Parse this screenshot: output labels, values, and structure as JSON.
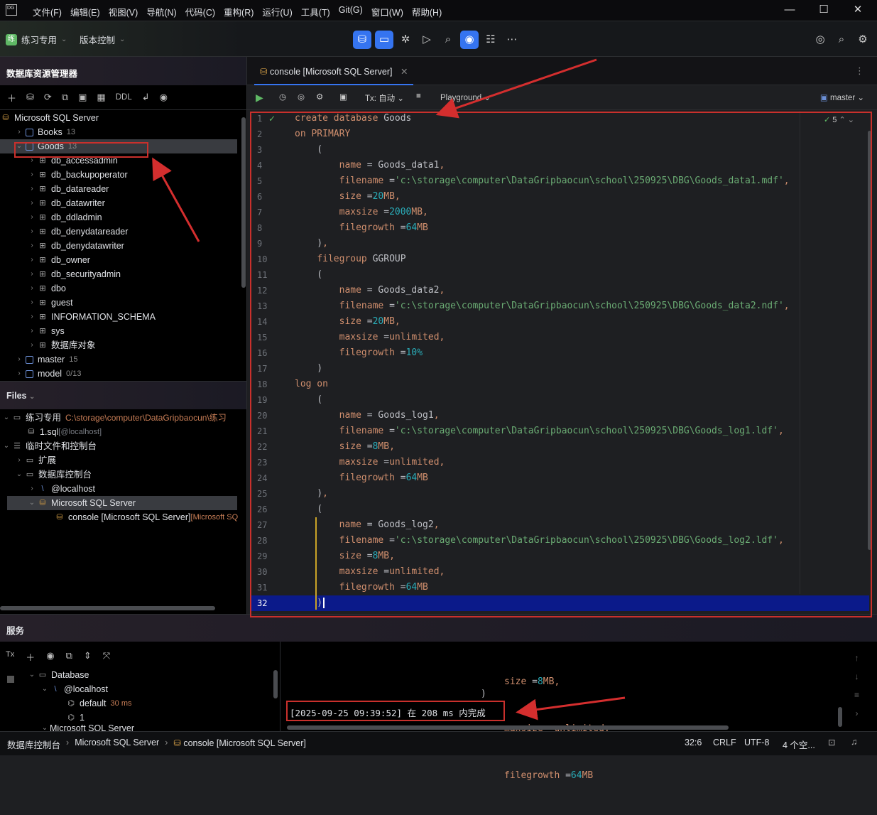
{
  "menu": [
    "文件(F)",
    "编辑(E)",
    "视图(V)",
    "导航(N)",
    "代码(C)",
    "重构(R)",
    "运行(U)",
    "工具(T)",
    "Git(G)",
    "窗口(W)",
    "帮助(H)"
  ],
  "app_logo": "DG",
  "toolbar": {
    "project": "练习专用",
    "vcs": "版本控制",
    "project_badge": "练"
  },
  "db_explorer": {
    "title": "数据库资源管理器",
    "ddl": "DDL",
    "root": "Microsoft SQL Server",
    "books": {
      "name": "Books",
      "count": "13"
    },
    "goods": {
      "name": "Goods",
      "count": "13"
    },
    "schemas": [
      "db_accessadmin",
      "db_backupoperator",
      "db_datareader",
      "db_datawriter",
      "db_ddladmin",
      "db_denydatareader",
      "db_denydatawriter",
      "db_owner",
      "db_securityadmin",
      "dbo",
      "guest",
      "INFORMATION_SCHEMA",
      "sys",
      "数据库对象"
    ],
    "master": {
      "name": "master",
      "count": "15"
    },
    "model": {
      "name": "model",
      "count": "0/13"
    }
  },
  "files": {
    "title": "Files",
    "practice": {
      "name": "练习专用",
      "path": "C:\\storage\\computer\\DataGripbaocun\\练习"
    },
    "sql_file": {
      "name": "1.sql",
      "host": "[@localhost]"
    },
    "scratches": "临时文件和控制台",
    "extensions": "扩展",
    "db_consoles": "数据库控制台",
    "localhost": "@localhost",
    "mssql": "Microsoft SQL Server",
    "console": "console [Microsoft SQL Server]",
    "console_suffix": "[Microsoft SQ"
  },
  "editor": {
    "tab": "console [Microsoft SQL Server]",
    "tx": "Tx: 自动",
    "playground": "Playground",
    "schema": "master",
    "checks": "5",
    "line_numbers": [
      "1",
      "2",
      "3",
      "4",
      "5",
      "6",
      "7",
      "8",
      "9",
      "10",
      "11",
      "12",
      "13",
      "14",
      "15",
      "16",
      "17",
      "18",
      "19",
      "20",
      "21",
      "22",
      "23",
      "24",
      "25",
      "26",
      "27",
      "28",
      "29",
      "30",
      "31",
      "32"
    ]
  },
  "code_lines": [
    [
      [
        "kw",
        "create database "
      ],
      [
        "pl",
        "Goods"
      ]
    ],
    [
      [
        "kw",
        "on PRIMARY"
      ]
    ],
    [
      [
        "pl",
        "    ("
      ]
    ],
    [
      [
        "pl",
        "        "
      ],
      [
        "kw",
        "name"
      ],
      [
        "pl",
        " = Goods_data1"
      ],
      [
        "kw",
        ","
      ]
    ],
    [
      [
        "pl",
        "        "
      ],
      [
        "kw",
        "filename"
      ],
      [
        "pl",
        " ="
      ],
      [
        "str",
        "'c:\\storage\\computer\\DataGripbaocun\\school\\250925\\DBG\\Goods_data1.mdf'"
      ],
      [
        "kw",
        ","
      ]
    ],
    [
      [
        "pl",
        "        "
      ],
      [
        "kw",
        "size"
      ],
      [
        "pl",
        " ="
      ],
      [
        "num",
        "20"
      ],
      [
        "kw",
        "MB,"
      ]
    ],
    [
      [
        "pl",
        "        "
      ],
      [
        "kw",
        "maxsize"
      ],
      [
        "pl",
        " ="
      ],
      [
        "num",
        "2000"
      ],
      [
        "kw",
        "MB,"
      ]
    ],
    [
      [
        "pl",
        "        "
      ],
      [
        "kw",
        "filegrowth"
      ],
      [
        "pl",
        " ="
      ],
      [
        "num",
        "64"
      ],
      [
        "kw",
        "MB"
      ]
    ],
    [
      [
        "pl",
        "    )"
      ],
      [
        "kw",
        ","
      ]
    ],
    [
      [
        "pl",
        "    "
      ],
      [
        "kw",
        "filegroup "
      ],
      [
        "pl",
        "GGROUP"
      ]
    ],
    [
      [
        "pl",
        "    ("
      ]
    ],
    [
      [
        "pl",
        "        "
      ],
      [
        "kw",
        "name"
      ],
      [
        "pl",
        " = Goods_data2"
      ],
      [
        "kw",
        ","
      ]
    ],
    [
      [
        "pl",
        "        "
      ],
      [
        "kw",
        "filename"
      ],
      [
        "pl",
        " ="
      ],
      [
        "str",
        "'c:\\storage\\computer\\DataGripbaocun\\school\\250925\\DBG\\Goods_data2.ndf'"
      ],
      [
        "kw",
        ","
      ]
    ],
    [
      [
        "pl",
        "        "
      ],
      [
        "kw",
        "size"
      ],
      [
        "pl",
        " ="
      ],
      [
        "num",
        "20"
      ],
      [
        "kw",
        "MB,"
      ]
    ],
    [
      [
        "pl",
        "        "
      ],
      [
        "kw",
        "maxsize"
      ],
      [
        "pl",
        " ="
      ],
      [
        "kw",
        "unlimited,"
      ]
    ],
    [
      [
        "pl",
        "        "
      ],
      [
        "kw",
        "filegrowth"
      ],
      [
        "pl",
        " ="
      ],
      [
        "num",
        "10%"
      ]
    ],
    [
      [
        "pl",
        "    )"
      ]
    ],
    [
      [
        "kw",
        "log on"
      ]
    ],
    [
      [
        "pl",
        "    ("
      ]
    ],
    [
      [
        "pl",
        "        "
      ],
      [
        "kw",
        "name"
      ],
      [
        "pl",
        " = Goods_log1"
      ],
      [
        "kw",
        ","
      ]
    ],
    [
      [
        "pl",
        "        "
      ],
      [
        "kw",
        "filename"
      ],
      [
        "pl",
        " ="
      ],
      [
        "str",
        "'c:\\storage\\computer\\DataGripbaocun\\school\\250925\\DBG\\Goods_log1.ldf'"
      ],
      [
        "kw",
        ","
      ]
    ],
    [
      [
        "pl",
        "        "
      ],
      [
        "kw",
        "size"
      ],
      [
        "pl",
        " ="
      ],
      [
        "num",
        "8"
      ],
      [
        "kw",
        "MB,"
      ]
    ],
    [
      [
        "pl",
        "        "
      ],
      [
        "kw",
        "maxsize"
      ],
      [
        "pl",
        " ="
      ],
      [
        "kw",
        "unlimited,"
      ]
    ],
    [
      [
        "pl",
        "        "
      ],
      [
        "kw",
        "filegrowth"
      ],
      [
        "pl",
        " ="
      ],
      [
        "num",
        "64"
      ],
      [
        "kw",
        "MB"
      ]
    ],
    [
      [
        "pl",
        "    )"
      ],
      [
        "kw",
        ","
      ]
    ],
    [
      [
        "pl",
        "    ("
      ]
    ],
    [
      [
        "pl",
        "        "
      ],
      [
        "kw",
        "name"
      ],
      [
        "pl",
        " = Goods_log2"
      ],
      [
        "kw",
        ","
      ]
    ],
    [
      [
        "pl",
        "        "
      ],
      [
        "kw",
        "filename"
      ],
      [
        "pl",
        " ="
      ],
      [
        "str",
        "'c:\\storage\\computer\\DataGripbaocun\\school\\250925\\DBG\\Goods_log2.ldf'"
      ],
      [
        "kw",
        ","
      ]
    ],
    [
      [
        "pl",
        "        "
      ],
      [
        "kw",
        "size"
      ],
      [
        "pl",
        " ="
      ],
      [
        "num",
        "8"
      ],
      [
        "kw",
        "MB,"
      ]
    ],
    [
      [
        "pl",
        "        "
      ],
      [
        "kw",
        "maxsize"
      ],
      [
        "pl",
        " ="
      ],
      [
        "kw",
        "unlimited,"
      ]
    ],
    [
      [
        "pl",
        "        "
      ],
      [
        "kw",
        "filegrowth"
      ],
      [
        "pl",
        " ="
      ],
      [
        "num",
        "64"
      ],
      [
        "kw",
        "MB"
      ]
    ],
    [
      [
        "pl",
        "    )"
      ]
    ]
  ],
  "services": {
    "title": "服务",
    "tx": "Tx",
    "database": "Database",
    "localhost": "@localhost",
    "default": "default",
    "default_time": "30 ms",
    "one": "1",
    "mssql": "Microsoft SQL Server",
    "output_size": "size =8MB,",
    "output_maxsize": "maxsize =unlimited,",
    "output_filegrowth": "filegrowth =64MB",
    "output_paren": ")",
    "result": "[2025-09-25 09:39:52] 在 208 ms 内完成"
  },
  "status": {
    "breadcrumb": [
      "数据库控制台",
      "Microsoft SQL Server",
      "console [Microsoft SQL Server]"
    ],
    "position": "32:6",
    "line_sep": "CRLF",
    "encoding": "UTF-8",
    "indent": "4 个空..."
  }
}
